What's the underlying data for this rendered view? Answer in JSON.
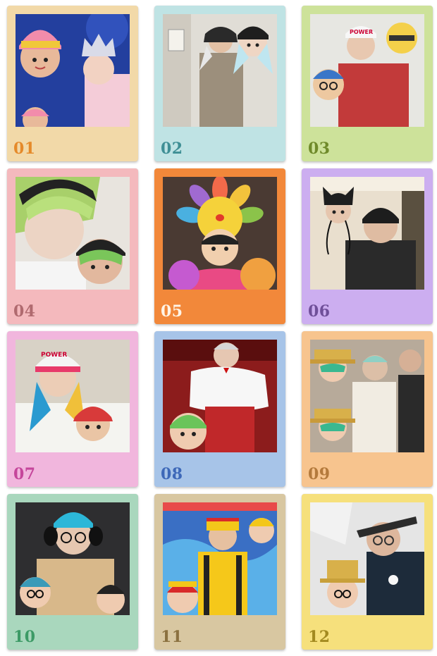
{
  "cards": [
    {
      "number": "01",
      "bg": "#f2d9a8",
      "num_color": "#e58a2a",
      "photo_bg": "#233f9e"
    },
    {
      "number": "02",
      "bg": "#bfe3e4",
      "num_color": "#3f8f95",
      "photo_bg": "#e0ddd6"
    },
    {
      "number": "03",
      "bg": "#cde29a",
      "num_color": "#6f8a2a",
      "photo_bg": "#e7e7e2"
    },
    {
      "number": "04",
      "bg": "#f4b9bd",
      "num_color": "#b06a6f",
      "photo_bg": "#e8e4de"
    },
    {
      "number": "05",
      "bg": "#f2883a",
      "num_color": "#fff4e6",
      "photo_bg": "#4a3a33"
    },
    {
      "number": "06",
      "bg": "#ccaef0",
      "num_color": "#6f4f99",
      "photo_bg": "#e9dfce"
    },
    {
      "number": "07",
      "bg": "#f1b6dd",
      "num_color": "#c5469b",
      "photo_bg": "#d8d2c6"
    },
    {
      "number": "08",
      "bg": "#a7c4e8",
      "num_color": "#3d68b8",
      "photo_bg": "#8c1c1c"
    },
    {
      "number": "09",
      "bg": "#f7c48e",
      "num_color": "#b47a3c",
      "photo_bg": "#b7aa9a"
    },
    {
      "number": "10",
      "bg": "#a9d7bd",
      "num_color": "#3d9a66",
      "photo_bg": "#2e2e30"
    },
    {
      "number": "11",
      "bg": "#d8c7a1",
      "num_color": "#8b7140",
      "photo_bg": "#3a6fc4"
    },
    {
      "number": "12",
      "bg": "#f6e07c",
      "num_color": "#a38a20",
      "photo_bg": "#e5e5e5"
    }
  ]
}
